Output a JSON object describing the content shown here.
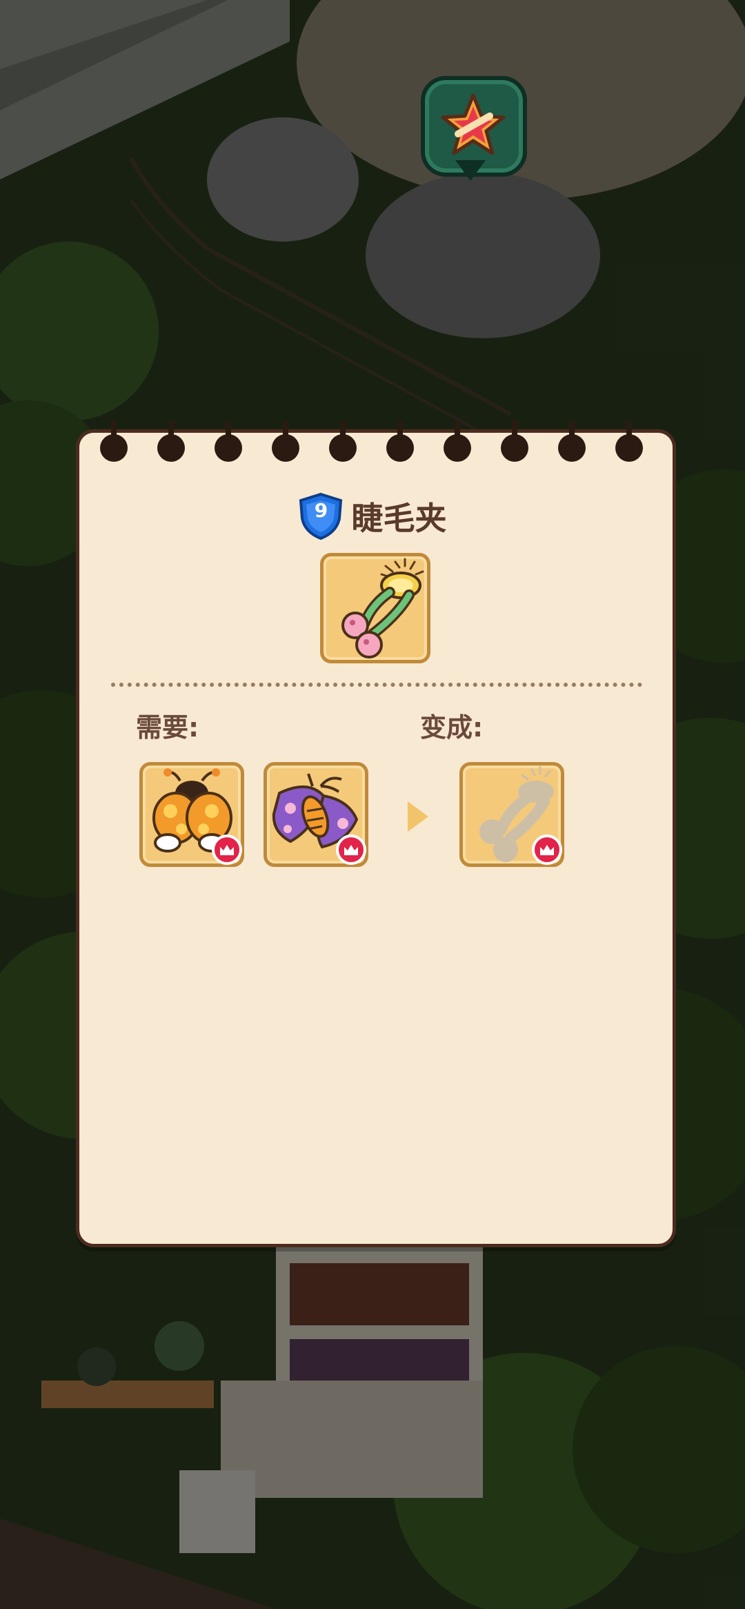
{
  "header": {
    "favorite_icon": "star-icon"
  },
  "item": {
    "level": "9",
    "title": "睫毛夹",
    "icon": "eyelash-curler-icon"
  },
  "recipe": {
    "needs_label": "需要:",
    "becomes_label": "变成:",
    "inputs": [
      {
        "name": "orange-beetle",
        "icon": "ladybug-icon",
        "badge": "crown-icon"
      },
      {
        "name": "purple-moth",
        "icon": "moth-icon",
        "badge": "crown-icon"
      }
    ],
    "output": {
      "name": "unknown-item",
      "icon": "silhouette-icon",
      "badge": "crown-icon"
    }
  },
  "colors": {
    "page": "#f8e9d2",
    "slot": "#f4c97a",
    "badge": "#e2234a",
    "level_shield": "#1e6fe0",
    "title_text": "#5a3a2a"
  }
}
